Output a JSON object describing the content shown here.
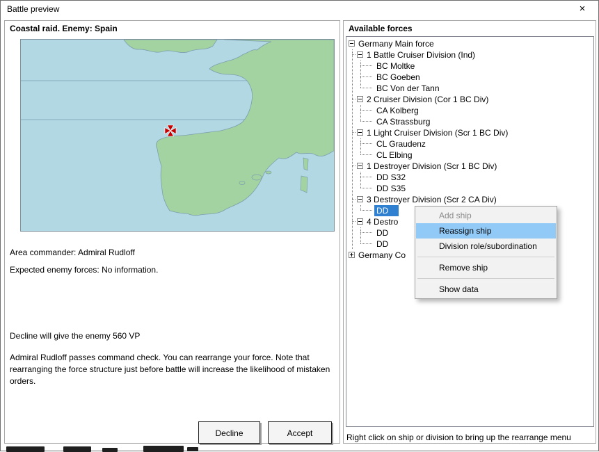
{
  "window": {
    "title": "Battle preview",
    "close_glyph": "×"
  },
  "left_panel": {
    "header": "Coastal raid. Enemy: Spain",
    "area_commander": "Area commander: Admiral Rudloff",
    "expected_forces": "Expected enemy forces:  No information.",
    "decline_vp": "Decline will give the enemy 560 VP",
    "command_check": "Admiral Rudloff passes command check. You can rearrange your force. Note that rearranging the force structure just before battle will increase the likelihood of mistaken orders.",
    "buttons": {
      "decline": "Decline",
      "accept": "Accept"
    },
    "map": {
      "marker_icon": "battle-location-cross",
      "sea_color": "#b2d8e4",
      "land_color": "#a3d3a0",
      "marker_color": "#c40000"
    }
  },
  "right_panel": {
    "header": "Available forces",
    "footer": "Right click on ship or division to bring up the rearrange menu",
    "tree": [
      {
        "label": "Germany Main force",
        "depth": 0,
        "box": "minus"
      },
      {
        "label": "1 Battle Cruiser Division (Ind)",
        "depth": 1,
        "box": "minus"
      },
      {
        "label": "BC Moltke",
        "depth": 2
      },
      {
        "label": "BC Goeben",
        "depth": 2
      },
      {
        "label": "BC Von der Tann",
        "depth": 2,
        "last": true
      },
      {
        "label": "2 Cruiser Division (Cor 1 BC Div)",
        "depth": 1,
        "box": "minus"
      },
      {
        "label": "CA Kolberg",
        "depth": 2
      },
      {
        "label": "CA Strassburg",
        "depth": 2,
        "last": true
      },
      {
        "label": "1 Light Cruiser Division (Scr 1 BC Div)",
        "depth": 1,
        "box": "minus"
      },
      {
        "label": "CL Graudenz",
        "depth": 2
      },
      {
        "label": "CL Elbing",
        "depth": 2,
        "last": true
      },
      {
        "label": "1 Destroyer Division (Scr 1 BC Div)",
        "depth": 1,
        "box": "minus"
      },
      {
        "label": "DD S32",
        "depth": 2
      },
      {
        "label": "DD S35",
        "depth": 2,
        "last": true
      },
      {
        "label": "3 Destroyer Division (Scr 2 CA Div)",
        "depth": 1,
        "box": "minus"
      },
      {
        "label": "DD",
        "depth": 2,
        "selected": true,
        "last": true
      },
      {
        "label": "4 Destro",
        "depth": 1,
        "box": "minus"
      },
      {
        "label": "DD",
        "depth": 2
      },
      {
        "label": "DD",
        "depth": 2,
        "last": true
      },
      {
        "label": "Germany Co",
        "depth": 0,
        "box": "plus",
        "last": true
      }
    ]
  },
  "context_menu": {
    "items": [
      {
        "label": "Add ship",
        "state": "disabled"
      },
      {
        "label": "Reassign ship",
        "state": "highlighted"
      },
      {
        "label": "Division role/subordination",
        "state": "normal"
      },
      {
        "separator": true
      },
      {
        "label": "Remove ship",
        "state": "normal"
      },
      {
        "separator": true
      },
      {
        "label": "Show data",
        "state": "normal"
      }
    ]
  },
  "colors": {
    "menu_highlight": "#91c9f7",
    "tree_selection_bg": "#2f80d0",
    "tree_selection_text": "#ffffff"
  }
}
